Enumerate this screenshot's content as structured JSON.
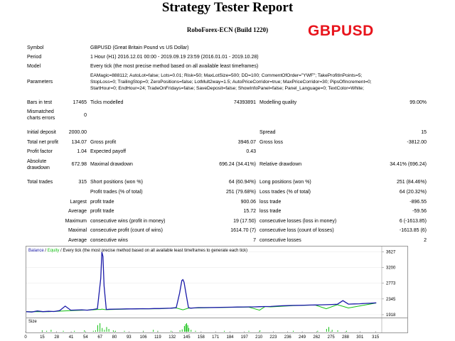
{
  "header": {
    "title": "Strategy Tester Report",
    "subtitle": "RoboForex-ECN (Build 1220)",
    "symbol_badge": "GBPUSD",
    "accent_color": "#e8141c"
  },
  "info": {
    "symbol_label": "Symbol",
    "symbol_value": "GBPUSD (Great Britain Pound vs US Dollar)",
    "period_label": "Period",
    "period_value": "1 Hour (H1) 2016.12.01 00:00 - 2019.09.19 23:59 (2016.01.01 - 2019.10.28)",
    "model_label": "Model",
    "model_value": "Every tick (the most precise method based on all available least timeframes)",
    "parameters_label": "Parameters",
    "parameters_lines": [
      "EAMagic=888112; AutoLot=false; Lots=0.01; Risk=50; MaxLotSize=500; DD=100; CommentOfOrder=\"YWF\"; TakeProfitInPoints=5;",
      "StopLoss=0; TrailingStop=0; ZeroPositions=false; LotMult2way=1.5; AutoPriceCorridor=true; MaxPriceCorridor=30; PipsOfIncrement=0;",
      "StartHour=0; EndHour=24; TradeOnFridays=false; SaveDeposit=false; ShowInfoPanel=false; Panel_Language=0; TextColor=White;"
    ]
  },
  "stats": {
    "bars_label": "Bars in test",
    "bars_value": "17465",
    "ticks_label": "Ticks modelled",
    "ticks_value": "74393891",
    "quality_label": "Modelling quality",
    "quality_value": "99.00%",
    "mismatched_label_1": "Mismatched",
    "mismatched_label_2": "charts errors",
    "mismatched_value": "0",
    "deposit_label": "Initial deposit",
    "deposit_value": "2000.00",
    "spread_label": "Spread",
    "spread_value": "15",
    "netprofit_label": "Total net profit",
    "netprofit_value": "134.07",
    "grossprofit_label": "Gross profit",
    "grossprofit_value": "3946.07",
    "grossloss_label": "Gross loss",
    "grossloss_value": "-3812.00",
    "pf_label": "Profit factor",
    "pf_value": "1.04",
    "payoff_label": "Expected payoff",
    "payoff_value": "0.43",
    "absdd_label_1": "Absolute",
    "absdd_label_2": "drawdown",
    "absdd_value": "672.98",
    "maxdd_label": "Maximal drawdown",
    "maxdd_value": "696.24 (34.41%)",
    "reldd_label": "Relative drawdown",
    "reldd_value": "34.41% (696.24)",
    "trades_label": "Total trades",
    "trades_value": "315",
    "short_label": "Short positions (won %)",
    "short_value": "64 (60.94%)",
    "long_label": "Long positions (won %)",
    "long_value": "251 (84.46%)",
    "profit_trades_label": "Profit trades (% of total)",
    "profit_trades_value": "251 (79.68%)",
    "loss_trades_label": "Loss trades (% of total)",
    "loss_trades_value": "64 (20.32%)",
    "largest_label": "Largest",
    "largest_pt_label": "profit trade",
    "largest_pt_value": "900.06",
    "largest_lt_label": "loss trade",
    "largest_lt_value": "-896.55",
    "average_label": "Average",
    "average_pt_label": "profit trade",
    "average_pt_value": "15.72",
    "average_lt_label": "loss trade",
    "average_lt_value": "-59.56",
    "maximum_label": "Maximum",
    "max_cw_label": "consecutive wins (profit in money)",
    "max_cw_value": "19 (17.50)",
    "max_cl_label": "consecutive losses (loss in money)",
    "max_cl_value": "6 (-1613.85)",
    "maximal_label": "Maximal",
    "maximal_cp_label": "consecutive profit (count of wins)",
    "maximal_cp_value": "1614.70 (7)",
    "maximal_cl_label": "consecutive loss (count of losses)",
    "maximal_cl_value": "-1613.85 (6)",
    "average2_label": "Average",
    "avg_cw_label": "consecutive wins",
    "avg_cw_value": "7",
    "avg_cl_label": "consecutive losses",
    "avg_cl_value": "2"
  },
  "chart_legend": {
    "balance": "Balance",
    "sep1": " / ",
    "equity": "Equity",
    "rest": " / Every tick (the most precise method based on all available least timeframes to generate each tick)",
    "balance_color": "#1a1aa8",
    "equity_color": "#10c010"
  },
  "size_label": "Size",
  "chart_data": {
    "type": "line",
    "xlabel": "",
    "ylabel": "",
    "x_ticks": [
      0,
      15,
      28,
      41,
      54,
      67,
      80,
      93,
      106,
      119,
      132,
      145,
      158,
      171,
      184,
      197,
      210,
      223,
      236,
      249,
      262,
      275,
      288,
      301,
      315
    ],
    "y_ticks": [
      1918,
      2345,
      2773,
      3200,
      3627
    ],
    "xlim": [
      0,
      320
    ],
    "ylim": [
      1840,
      3770
    ],
    "series": [
      {
        "name": "Balance",
        "color": "#1a1aa8",
        "x": [
          0,
          5,
          10,
          15,
          20,
          25,
          30,
          35,
          40,
          45,
          50,
          55,
          60,
          64,
          67,
          68,
          69,
          70,
          72,
          75,
          80,
          85,
          90,
          95,
          100,
          105,
          110,
          115,
          120,
          125,
          130,
          135,
          138,
          140,
          141,
          142,
          144,
          146,
          148,
          150,
          155,
          160,
          165,
          170,
          175,
          180,
          185,
          190,
          195,
          200,
          205,
          210,
          215,
          220,
          225,
          230,
          235,
          240,
          245,
          250,
          255,
          260,
          265,
          270,
          275,
          280,
          285,
          290,
          295,
          300,
          305,
          310,
          315
        ],
        "y": [
          2000,
          1990,
          2020,
          2000,
          2010,
          2005,
          2030,
          2150,
          2040,
          2045,
          2050,
          2040,
          2060,
          2080,
          2900,
          3620,
          3500,
          2700,
          2060,
          2065,
          2070,
          2072,
          2075,
          2075,
          2078,
          2082,
          2080,
          2085,
          2085,
          2090,
          2095,
          2110,
          2500,
          2850,
          2870,
          2800,
          2450,
          2110,
          2095,
          2100,
          2110,
          2110,
          2112,
          2115,
          2118,
          2120,
          2122,
          2125,
          2128,
          2130,
          2130,
          2135,
          2140,
          2142,
          2150,
          2160,
          2165,
          2170,
          2172,
          2175,
          2180,
          2182,
          2185,
          2190,
          2195,
          2200,
          2300,
          2205,
          2210,
          2215,
          2225,
          2230,
          2240
        ]
      },
      {
        "name": "Equity",
        "color": "#10c010",
        "x": [
          0,
          20,
          40,
          60,
          64,
          67,
          68,
          70,
          72,
          100,
          120,
          135,
          141,
          146,
          170,
          200,
          210,
          215,
          220,
          240,
          260,
          270,
          280,
          290,
          315
        ],
        "y": [
          2000,
          2000,
          2030,
          2050,
          2060,
          2060,
          2070,
          2060,
          2055,
          2075,
          2080,
          2100,
          2050,
          2095,
          2110,
          2125,
          2040,
          2140,
          2130,
          2165,
          2180,
          2080,
          2190,
          2100,
          2235
        ]
      }
    ],
    "size_bars": {
      "x": [
        14,
        18,
        22,
        33,
        43,
        52,
        60,
        62,
        64,
        66,
        68,
        70,
        72,
        74,
        78,
        80,
        88,
        105,
        114,
        118,
        130,
        138,
        140,
        142,
        143,
        144,
        145,
        146,
        148,
        152,
        178,
        200,
        210,
        240,
        262,
        270,
        272,
        275,
        280,
        288
      ],
      "y": [
        3,
        2,
        4,
        2,
        2,
        3,
        2,
        3,
        14,
        18,
        8,
        4,
        10,
        6,
        3,
        2,
        2,
        2,
        4,
        2,
        2,
        3,
        5,
        12,
        16,
        18,
        14,
        8,
        4,
        2,
        2,
        2,
        3,
        2,
        2,
        6,
        10,
        4,
        3,
        2
      ]
    }
  }
}
